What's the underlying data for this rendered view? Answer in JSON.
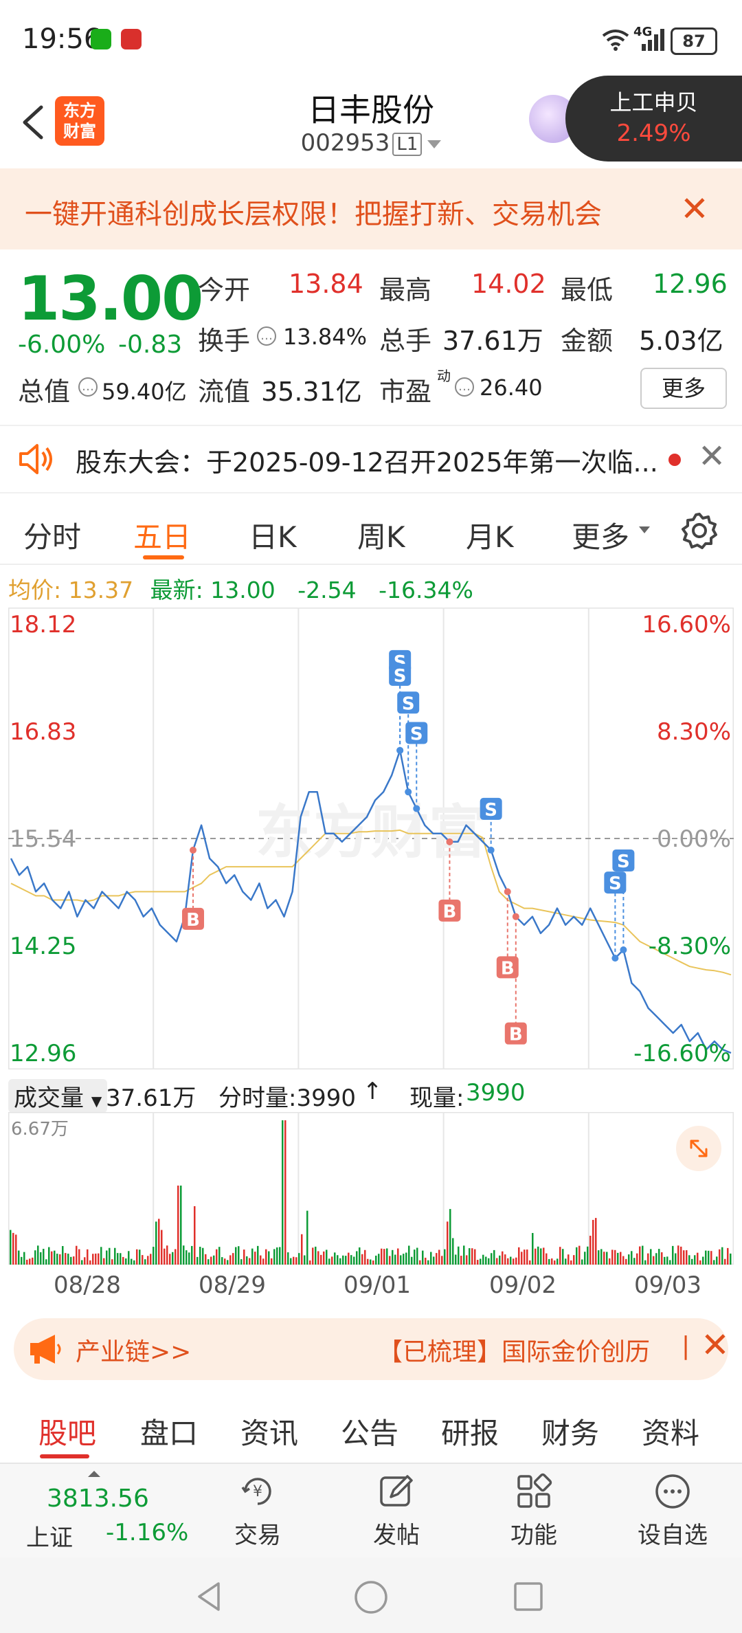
{
  "status": {
    "time": "19:56",
    "network": "4G",
    "battery": "87"
  },
  "header": {
    "logo_text_line1": "东方",
    "logo_text_line2": "财富",
    "name": "日丰股份",
    "code": "002953",
    "level": "L1"
  },
  "popup": {
    "name": "上工申贝",
    "pct": "2.49%"
  },
  "promo": {
    "text": "一键开通科创成长层权限！把握打新、交易机会"
  },
  "quote": {
    "price": "13.00",
    "chg_pct": "-6.00%",
    "chg": "-0.83",
    "open_label": "今开",
    "open": "13.84",
    "high_label": "最高",
    "high": "14.02",
    "low_label": "最低",
    "low": "12.96",
    "turnover_label": "换手",
    "turnover": "13.84%",
    "volume_label": "总手",
    "volume": "37.61万",
    "amount_label": "金额",
    "amount": "5.03亿",
    "mktcap_label": "总值",
    "mktcap": "59.40亿",
    "float_label": "流值",
    "float": "35.31亿",
    "pe_label": "市盈",
    "pe_sup": "动",
    "pe": "26.40",
    "more_label": "更多"
  },
  "notice": {
    "text": "股东大会：于2025-09-12召开2025年第一次临..."
  },
  "ktabs": [
    "分时",
    "五日",
    "日K",
    "周K",
    "月K",
    "更多"
  ],
  "infoline": {
    "avg_label": "均价:",
    "avg": "13.37",
    "last_label": "最新:",
    "last": "13.00",
    "chg": "-2.54",
    "chg_pct": "-16.34%"
  },
  "chart_data": {
    "type": "line",
    "y_left_ticks": [
      "18.12",
      "16.83",
      "15.54",
      "14.25",
      "12.96"
    ],
    "y_right_ticks": [
      "16.60%",
      "8.30%",
      "0.00%",
      "-8.30%",
      "-16.60%"
    ],
    "ylim": [
      12.96,
      18.12
    ],
    "baseline": 15.54,
    "days": [
      "08/28",
      "08/29",
      "09/01",
      "09/02",
      "09/03"
    ],
    "series": [
      {
        "values": [
          15.3,
          15.1,
          15.2,
          14.9,
          15.0,
          14.8,
          14.7,
          14.9,
          14.6,
          14.8,
          14.7,
          14.9,
          14.8,
          14.7,
          14.9,
          14.8,
          14.6,
          14.7,
          14.5,
          14.4,
          14.3,
          14.6,
          15.4,
          15.7,
          15.3,
          15.2,
          15.0,
          15.1,
          14.9,
          14.8,
          15.0,
          14.7,
          14.8,
          14.6,
          14.9,
          15.8,
          16.1,
          16.1,
          15.6,
          15.6,
          15.5,
          15.6,
          15.7,
          15.8,
          16.0,
          16.1,
          16.3,
          16.6,
          16.1,
          15.9,
          15.7,
          15.6,
          15.6,
          15.5,
          15.5,
          15.7,
          15.6,
          15.5,
          15.4,
          15.1,
          14.9,
          14.6,
          14.5,
          14.6,
          14.4,
          14.5,
          14.7,
          14.5,
          14.6,
          14.5,
          14.7,
          14.5,
          14.3,
          14.1,
          14.2,
          13.8,
          13.7,
          13.5,
          13.4,
          13.3,
          13.2,
          13.3,
          13.1,
          13.2,
          13.0,
          13.1,
          13.0,
          12.96
        ]
      },
      {
        "values": [
          15.0,
          14.95,
          14.9,
          14.85,
          14.85,
          14.8,
          14.8,
          14.8,
          14.8,
          14.78,
          14.8,
          14.85,
          14.85,
          14.85,
          14.88,
          14.9,
          14.9,
          14.9,
          14.9,
          14.9,
          14.9,
          14.9,
          14.95,
          15.0,
          15.1,
          15.15,
          15.2,
          15.2,
          15.2,
          15.2,
          15.2,
          15.2,
          15.2,
          15.2,
          15.2,
          15.3,
          15.4,
          15.5,
          15.6,
          15.6,
          15.6,
          15.6,
          15.62,
          15.62,
          15.63,
          15.63,
          15.63,
          15.64,
          15.6,
          15.6,
          15.6,
          15.6,
          15.6,
          15.6,
          15.6,
          15.6,
          15.6,
          15.55,
          15.2,
          14.9,
          14.8,
          14.75,
          14.7,
          14.7,
          14.68,
          14.66,
          14.64,
          14.62,
          14.6,
          14.58,
          14.56,
          14.55,
          14.54,
          14.53,
          14.5,
          14.4,
          14.3,
          14.25,
          14.2,
          14.15,
          14.1,
          14.05,
          14.0,
          13.98,
          13.96,
          13.95,
          13.93,
          13.9
        ]
      }
    ],
    "markers": [
      {
        "label": "B",
        "type": "buy"
      },
      {
        "label": "S",
        "type": "sell"
      },
      {
        "label": "S",
        "type": "sell"
      },
      {
        "label": "S",
        "type": "sell"
      },
      {
        "label": "S",
        "type": "sell"
      },
      {
        "label": "B",
        "type": "buy"
      },
      {
        "label": "S",
        "type": "sell"
      },
      {
        "label": "B",
        "type": "buy"
      },
      {
        "label": "B",
        "type": "buy"
      },
      {
        "label": "S",
        "type": "sell"
      },
      {
        "label": "S",
        "type": "sell"
      }
    ]
  },
  "volume": {
    "label": "成交量",
    "total": "37.61万",
    "tick_label": "分时量:3990",
    "now_label": "现量:",
    "now": "3990",
    "max": "6.67万"
  },
  "adbar": {
    "link": "产业链>>",
    "msg": "【已梳理】国际金价创历",
    "sep": "|"
  },
  "btabs": [
    "股吧",
    "盘口",
    "资讯",
    "公告",
    "研报",
    "财务",
    "资料"
  ],
  "toolbar": {
    "index_value": "3813.56",
    "index_name": "上证",
    "index_chg": "-1.16%",
    "items": [
      "交易",
      "发帖",
      "功能",
      "设自选"
    ]
  },
  "colors": {
    "accent": "#ff6a13",
    "up": "#e0302b",
    "down": "#0d9b36",
    "line": "#3a78c9",
    "avg": "#e9c45a"
  }
}
